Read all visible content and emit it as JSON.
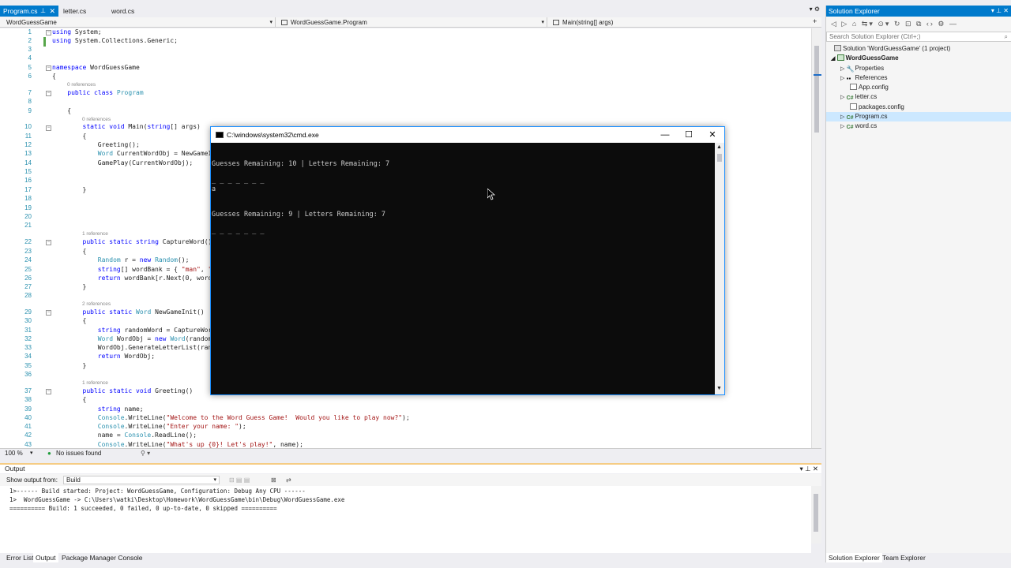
{
  "tabs": [
    {
      "label": "Program.cs",
      "active": true
    },
    {
      "label": "letter.cs",
      "active": false
    },
    {
      "label": "word.cs",
      "active": false
    }
  ],
  "nav": {
    "project": "WordGuessGame",
    "class": "WordGuessGame.Program",
    "member": "Main(string[] args)"
  },
  "code_lines": [
    {
      "n": "1",
      "code": "using System;"
    },
    {
      "n": "2",
      "code": "using System.Collections.Generic;"
    },
    {
      "n": "3",
      "code": ""
    },
    {
      "n": "4",
      "code": ""
    },
    {
      "n": "5",
      "code": "namespace WordGuessGame"
    },
    {
      "n": "6",
      "code": "{"
    },
    {
      "n": "7",
      "code": "    public class Program"
    },
    {
      "n": "8",
      "code": ""
    },
    {
      "n": "9",
      "code": "    {"
    },
    {
      "n": "10",
      "code": "        static void Main(string[] args)"
    },
    {
      "n": "11",
      "code": "        {"
    },
    {
      "n": "12",
      "code": "            Greeting();"
    },
    {
      "n": "13",
      "code": "            Word CurrentWordObj = NewGameI"
    },
    {
      "n": "14",
      "code": "            GamePlay(CurrentWordObj);"
    },
    {
      "n": "15",
      "code": ""
    },
    {
      "n": "16",
      "code": ""
    },
    {
      "n": "17",
      "code": "        }"
    },
    {
      "n": "18",
      "code": ""
    },
    {
      "n": "19",
      "code": ""
    },
    {
      "n": "20",
      "code": ""
    },
    {
      "n": "21",
      "code": ""
    },
    {
      "n": "22",
      "code": "        public static string CaptureWord()"
    },
    {
      "n": "23",
      "code": "        {"
    },
    {
      "n": "24",
      "code": "            Random r = new Random();"
    },
    {
      "n": "25",
      "code": "            string[] wordBank = { \"man\", \""
    },
    {
      "n": "26",
      "code": "            return wordBank[r.Next(0, word"
    },
    {
      "n": "27",
      "code": "        }"
    },
    {
      "n": "28",
      "code": ""
    },
    {
      "n": "29",
      "code": "        public static Word NewGameInit()"
    },
    {
      "n": "30",
      "code": "        {"
    },
    {
      "n": "31",
      "code": "            string randomWord = CaptureWor"
    },
    {
      "n": "32",
      "code": "            Word WordObj = new Word(random"
    },
    {
      "n": "33",
      "code": "            WordObj.GenerateLetterList(ran"
    },
    {
      "n": "34",
      "code": "            return WordObj;"
    },
    {
      "n": "35",
      "code": "        }"
    },
    {
      "n": "36",
      "code": ""
    },
    {
      "n": "37",
      "code": "        public static void Greeting()"
    },
    {
      "n": "38",
      "code": "        {"
    },
    {
      "n": "39",
      "code": "            string name;"
    },
    {
      "n": "40",
      "code": "            Console.WriteLine(\"Welcome to the Word Guess Game!  Would you like to play now?\");"
    },
    {
      "n": "41",
      "code": "            Console.WriteLine(\"Enter your name: \");"
    },
    {
      "n": "42",
      "code": "            name = Console.ReadLine();"
    },
    {
      "n": "43",
      "code": "            Console.WriteLine(\"What's up {0}! Let's play!\", name);"
    }
  ],
  "refs": {
    "r7": "0 references",
    "r10": "0 references",
    "r22": "1 reference",
    "r29": "2 references",
    "r37": "1 reference"
  },
  "editor_status": {
    "zoom": "100 %",
    "issues": "No issues found"
  },
  "output": {
    "title": "Output",
    "show_from_label": "Show output from:",
    "source": "Build",
    "lines": [
      "1>------ Build started: Project: WordGuessGame, Configuration: Debug Any CPU ------",
      "1>  WordGuessGame -> C:\\Users\\watki\\Desktop\\Homework\\WordGuessGame\\bin\\Debug\\WordGuessGame.exe",
      "========== Build: 1 succeeded, 0 failed, 0 up-to-date, 0 skipped =========="
    ]
  },
  "bottom_tabs": [
    "Error List",
    "Output",
    "Package Manager Console"
  ],
  "solution_explorer": {
    "title": "Solution Explorer",
    "search_placeholder": "Search Solution Explorer (Ctrl+;)",
    "items": [
      {
        "label": "Solution 'WordGuessGame' (1 project)"
      },
      {
        "label": "WordGuessGame"
      },
      {
        "label": "Properties"
      },
      {
        "label": "References"
      },
      {
        "label": "App.config"
      },
      {
        "label": "letter.cs"
      },
      {
        "label": "packages.config"
      },
      {
        "label": "Program.cs"
      },
      {
        "label": "word.cs"
      }
    ],
    "bottom_tabs": [
      "Solution Explorer",
      "Team Explorer"
    ]
  },
  "cmd": {
    "title": "C:\\windows\\system32\\cmd.exe",
    "lines": [
      "Guesses Remaining: 10 | Letters Remaining: 7",
      "_ _ _ _ _ _ _",
      "a",
      "Guesses Remaining: 9 | Letters Remaining: 7",
      "_ _ _ _ _ _ _"
    ]
  },
  "colors": {
    "accent": "#007acc",
    "console_bg": "#0c0c0c",
    "console_fg": "#cccccc"
  }
}
